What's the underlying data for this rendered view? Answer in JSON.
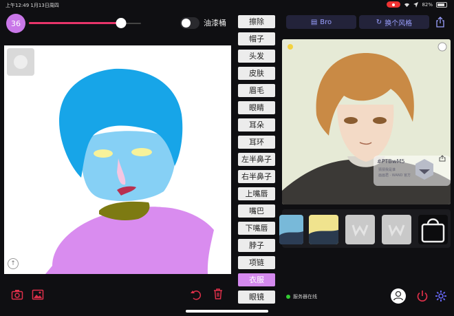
{
  "status_bar": {
    "time": "上午12:49",
    "date": "1月13日周四",
    "battery": "82%",
    "battery_level": 0.82
  },
  "brush": {
    "size": "36",
    "size_fraction": 0.82
  },
  "paint_bucket_label": "油漆桶",
  "parts": [
    {
      "label": "擦除",
      "selected": false
    },
    {
      "label": "帽子",
      "selected": false
    },
    {
      "label": "头发",
      "selected": false
    },
    {
      "label": "皮肤",
      "selected": false
    },
    {
      "label": "眉毛",
      "selected": false
    },
    {
      "label": "眼睛",
      "selected": false
    },
    {
      "label": "耳朵",
      "selected": false
    },
    {
      "label": "耳环",
      "selected": false
    },
    {
      "label": "左半鼻子",
      "selected": false
    },
    {
      "label": "右半鼻子",
      "selected": false
    },
    {
      "label": "上嘴唇",
      "selected": false
    },
    {
      "label": "嘴巴",
      "selected": false
    },
    {
      "label": "下嘴唇",
      "selected": false
    },
    {
      "label": "脖子",
      "selected": false
    },
    {
      "label": "项链",
      "selected": false
    },
    {
      "label": "衣服",
      "selected": true
    },
    {
      "label": "眼镜",
      "selected": false
    }
  ],
  "toolbar": {
    "bro_label": "Bro",
    "change_style_label": "换个风格"
  },
  "result": {
    "watermark_id": "#PTBwM5",
    "watermark_line1": "猜猜我是谁",
    "watermark_line2": "画画君 · WAND 官方"
  },
  "server_status": "服务器在线",
  "colors": {
    "accent_pink": "#e8346a",
    "brush_purple": "#c977e8",
    "selected_part": "#d489ee",
    "icon_red": "#e0304a",
    "icon_blue": "#6b6bff",
    "top_button_text": "#9aa0ff"
  },
  "icons": {
    "camera": "camera-icon",
    "gallery": "image-icon",
    "undo": "undo-icon",
    "delete": "trash-icon",
    "share": "share-icon",
    "user": "user-icon",
    "power": "power-icon",
    "settings": "gear-icon",
    "upload": "upload-icon"
  }
}
